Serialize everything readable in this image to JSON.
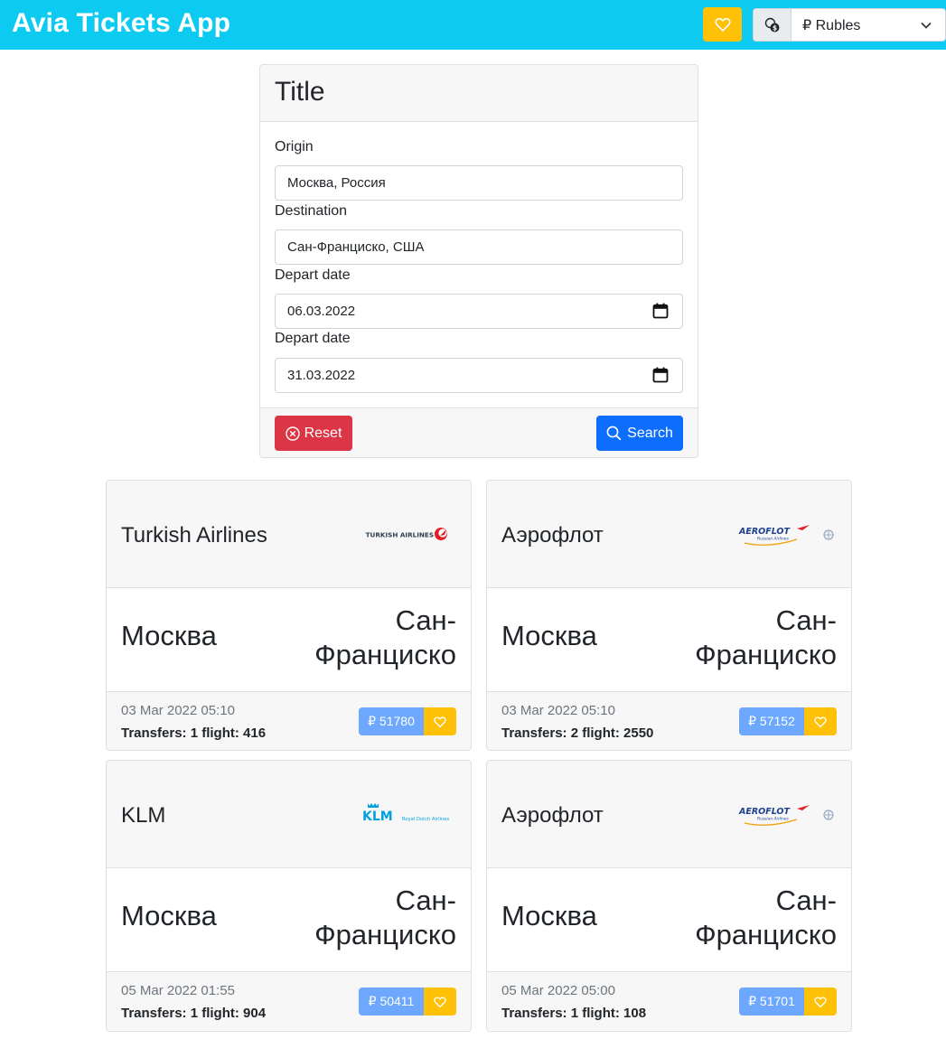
{
  "navbar": {
    "brand": "Avia Tickets App",
    "favorites_icon": "heart-icon",
    "currency_icon": "coins-icon",
    "currency_value": "₽ Rubles"
  },
  "search": {
    "title": "Title",
    "origin_label": "Origin",
    "origin_value": "Москва, Россия",
    "destination_label": "Destination",
    "destination_value": "Сан-Франциско, США",
    "depart_label": "Depart date",
    "depart_value": "06.03.2022",
    "return_label": "Depart date",
    "return_value": "31.03.2022",
    "reset_label": "Reset",
    "search_label": "Search"
  },
  "tickets": [
    {
      "airline": "Turkish Airlines",
      "logo": "TURKISH AIRLINES",
      "origin": "Москва",
      "destination": "Сан-Франциско",
      "date": "03 Mar 2022 05:10",
      "transfers": "Transfers: 1 flight: 416",
      "price": "₽ 51780"
    },
    {
      "airline": "Аэрофлот",
      "logo": "AEROFLOT",
      "logo_sub": "Russian Airlines",
      "origin": "Москва",
      "destination": "Сан-Франциско",
      "date": "03 Mar 2022 05:10",
      "transfers": "Transfers: 2 flight: 2550",
      "price": "₽ 57152"
    },
    {
      "airline": "KLM",
      "logo": "KLM",
      "logo_sub": "Royal Dutch Airlines",
      "origin": "Москва",
      "destination": "Сан-Франциско",
      "date": "05 Mar 2022 01:55",
      "transfers": "Transfers: 1 flight: 904",
      "price": "₽ 50411"
    },
    {
      "airline": "Аэрофлот",
      "logo": "AEROFLOT",
      "logo_sub": "Russian Airlines",
      "origin": "Москва",
      "destination": "Сан-Франциско",
      "date": "05 Mar 2022 05:00",
      "transfers": "Transfers: 1 flight: 108",
      "price": "₽ 51701"
    }
  ],
  "colors": {
    "navbar": "#0dcaf0",
    "favorite": "#ffc107",
    "reset": "#dc3545",
    "search": "#0d6efd",
    "price": "#6ea8fe"
  }
}
